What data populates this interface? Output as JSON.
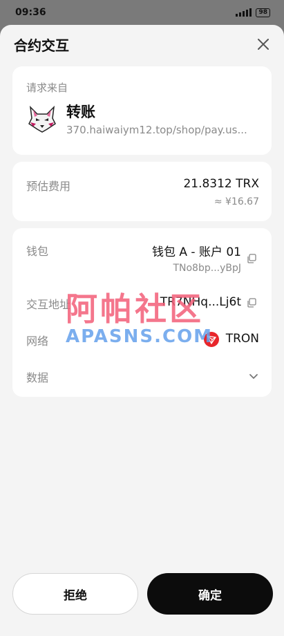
{
  "status": {
    "time": "09:36",
    "battery": "98"
  },
  "header": {
    "title": "合约交互",
    "close_icon": "close-icon"
  },
  "request": {
    "label": "请求来自",
    "title": "转账",
    "url": "370.haiwaiym12.top/shop/pay.us...",
    "logo_icon": "wolf-logo-icon"
  },
  "fee": {
    "label": "预估费用",
    "amount": "21.8312 TRX",
    "fiat": "≈ ¥16.67"
  },
  "details": {
    "wallet_label": "钱包",
    "wallet_name": "钱包 A - 账户 01",
    "wallet_address": "TNo8bp...yBpJ",
    "contract_label": "交互地址",
    "contract_address": "TR7NHq...Lj6t",
    "network_label": "网络",
    "network_name": "TRON",
    "data_label": "数据"
  },
  "watermark": {
    "cn": "阿帕社区",
    "en": "APASNS.COM"
  },
  "actions": {
    "reject": "拒绝",
    "confirm": "确定"
  },
  "colors": {
    "tron_red": "#e8262b",
    "confirm_bg": "#0c0c0c",
    "sheet_bg": "#f4f4f4"
  }
}
